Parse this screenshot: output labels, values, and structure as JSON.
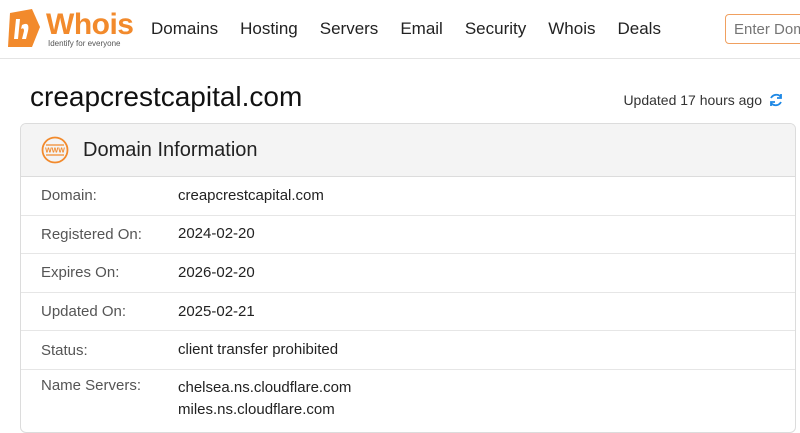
{
  "header": {
    "logo_text": "Whois",
    "logo_tagline": "Identify for everyone",
    "nav": [
      "Domains",
      "Hosting",
      "Servers",
      "Email",
      "Security",
      "Whois",
      "Deals"
    ],
    "search_placeholder": "Enter Domain",
    "accent_color": "#f28a2c"
  },
  "page": {
    "title": "creapcrestcapital.com",
    "updated_text": "Updated 17 hours ago"
  },
  "domain_info": {
    "title": "Domain Information",
    "icon": "www-icon",
    "rows": [
      {
        "label": "Domain:",
        "values": [
          "creapcrestcapital.com"
        ]
      },
      {
        "label": "Registered On:",
        "values": [
          "2024-02-20"
        ]
      },
      {
        "label": "Expires On:",
        "values": [
          "2026-02-20"
        ]
      },
      {
        "label": "Updated On:",
        "values": [
          "2025-02-21"
        ]
      },
      {
        "label": "Status:",
        "values": [
          "client transfer prohibited"
        ]
      },
      {
        "label": "Name Servers:",
        "values": [
          "chelsea.ns.cloudflare.com",
          "miles.ns.cloudflare.com"
        ]
      }
    ]
  }
}
